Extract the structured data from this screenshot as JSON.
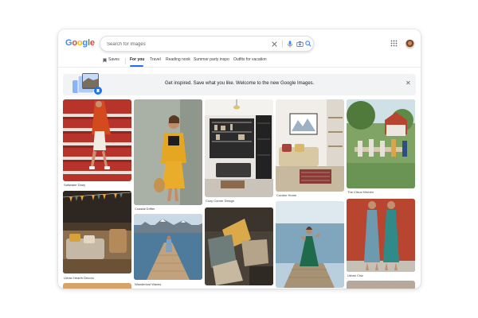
{
  "brand": {
    "logo_letters": [
      "G",
      "o",
      "o",
      "g",
      "l",
      "e"
    ],
    "logo_colors": [
      "#4285F4",
      "#EA4335",
      "#FBBC05",
      "#4285F4",
      "#34A853",
      "#EA4335"
    ]
  },
  "search": {
    "placeholder": "Search for images",
    "value": ""
  },
  "nav": {
    "saves": "Saves",
    "tabs": [
      "For you",
      "Travel",
      "Reading nook",
      "Summer party inspo",
      "Outfits for vacation"
    ],
    "active_tab": "For you"
  },
  "banner": {
    "message": "Get inspired. Save what you like. Welcome to the new Google Images.",
    "close_icon": "close-icon"
  },
  "cards": [
    {
      "caption": "Saltwater Diary",
      "image": "red-stairs-fashion"
    },
    {
      "caption": "Coastal Drifter",
      "image": "yellow-outfit-fashion"
    },
    {
      "caption": "Cozy Corner Design",
      "image": "dark-kitchen-interior"
    },
    {
      "caption": "Curator Home",
      "image": "living-room-interior"
    },
    {
      "caption": "The Citrus Kitchen",
      "image": "outdoor-garden-party"
    },
    {
      "caption": "Urban Hearth Decors",
      "image": "patio-lounge-bunting"
    },
    {
      "caption": "Wanderlust Waves",
      "image": "lake-pier-mountains"
    },
    {
      "caption": "",
      "image": "cushions-rattan-sofa"
    },
    {
      "caption": "",
      "image": "green-dress-pier"
    },
    {
      "caption": "Urban Chic",
      "image": "two-women-dresses"
    }
  ],
  "colors": {
    "accent": "#1a73e8",
    "banner_bg": "#f1f3f4"
  }
}
